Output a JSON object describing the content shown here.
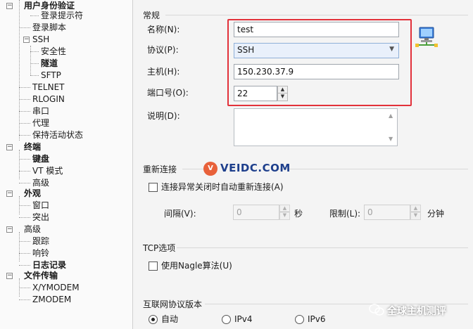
{
  "tree": {
    "items": [
      {
        "label": "用户身份验证",
        "bold": true
      },
      {
        "label": "登录提示符"
      },
      {
        "label": "登录脚本"
      },
      {
        "label": "SSH",
        "expander": "−"
      },
      {
        "label": "安全性"
      },
      {
        "label": "隧道",
        "bold": true
      },
      {
        "label": "SFTP"
      },
      {
        "label": "TELNET"
      },
      {
        "label": "RLOGIN"
      },
      {
        "label": "串口"
      },
      {
        "label": "代理"
      },
      {
        "label": "保持活动状态"
      },
      {
        "label": "终端",
        "bold": true,
        "expander": "−"
      },
      {
        "label": "键盘",
        "bold": true
      },
      {
        "label": "VT 模式"
      },
      {
        "label": "高级"
      },
      {
        "label": "外观",
        "bold": true,
        "expander": "−"
      },
      {
        "label": "窗口"
      },
      {
        "label": "突出"
      },
      {
        "label": "高级",
        "expander": "−"
      },
      {
        "label": "跟踪"
      },
      {
        "label": "响铃"
      },
      {
        "label": "日志记录",
        "bold": true
      },
      {
        "label": "文件传输",
        "bold": true,
        "expander": "−"
      },
      {
        "label": "X/YMODEM"
      },
      {
        "label": "ZMODEM"
      }
    ]
  },
  "general": {
    "section_title": "常规",
    "name_label": "名称(N):",
    "name_value": "test",
    "protocol_label": "协议(P):",
    "protocol_value": "SSH",
    "host_label": "主机(H):",
    "host_value": "150.230.37.9",
    "port_label": "端口号(O):",
    "port_value": "22",
    "desc_label": "说明(D):",
    "desc_value": ""
  },
  "reconnect": {
    "section_title": "重新连接",
    "auto_reconnect_label": "连接异常关闭时自动重新连接(A)",
    "auto_reconnect_checked": false,
    "interval_label": "间隔(V):",
    "interval_value": "0",
    "interval_unit": "秒",
    "limit_label": "限制(L):",
    "limit_value": "0",
    "limit_unit": "分钟"
  },
  "tcp": {
    "section_title": "TCP选项",
    "nagle_label": "使用Nagle算法(U)",
    "nagle_checked": false
  },
  "ip_version": {
    "section_title": "互联网协议版本",
    "options": [
      "自动",
      "IPv4",
      "IPv6"
    ],
    "selected": "自动"
  },
  "overlays": {
    "site_logo_text": "VEIDC.COM",
    "watermark_text": "全球主机测评"
  },
  "colors": {
    "highlight": "#e2313a",
    "select_bg": "#e9f0fb",
    "logo_text": "#1e3f8c"
  }
}
